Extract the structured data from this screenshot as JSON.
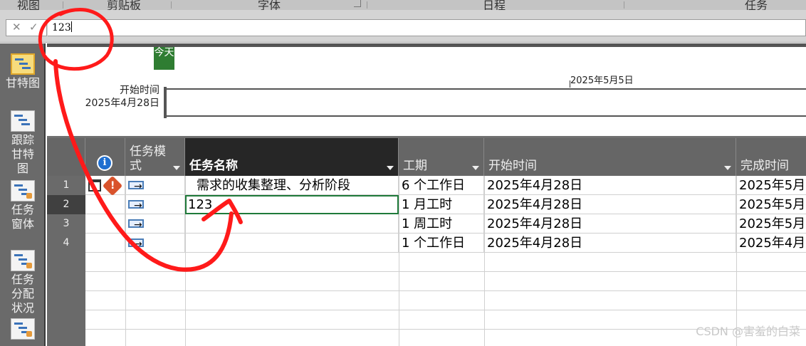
{
  "ribbon": {
    "groups": [
      "视图",
      "剪贴板",
      "字体",
      "日程",
      "任务"
    ]
  },
  "formula_bar": {
    "cancel_icon": "✕",
    "enter_icon": "✓",
    "value": "123"
  },
  "view_bar": {
    "items": [
      {
        "label": "甘特图",
        "icon": "gantt-chart-icon"
      },
      {
        "label": "跟踪甘特图",
        "icon": "tracking-gantt-icon"
      },
      {
        "label": "任务窗体",
        "icon": "task-form-icon"
      },
      {
        "label": "任务分配状况",
        "icon": "task-usage-icon"
      },
      {
        "label": "",
        "icon": "calendar-view-icon"
      }
    ]
  },
  "timeline": {
    "today_label": "今天",
    "start_label": "开始时间",
    "start_date": "2025年4月28日",
    "date_marker": "2025年5月5日"
  },
  "table": {
    "columns": [
      "",
      "任务模式",
      "任务名称",
      "工期",
      "开始时间",
      "完成时间"
    ],
    "rows": [
      {
        "id": "1",
        "name": "需求的收集整理、分析阶段",
        "duration": "6 个工作日",
        "start": "2025年4月28日",
        "finish": "2025年5月",
        "indicators": [
          "calendar-icon",
          "warning-icon"
        ]
      },
      {
        "id": "2",
        "name": "123",
        "duration": "1 月工时",
        "start": "2025年4月28日",
        "finish": "2025年5月",
        "indicators": []
      },
      {
        "id": "3",
        "name": "",
        "duration": "1 周工时",
        "start": "2025年4月28日",
        "finish": "2025年5月",
        "indicators": []
      },
      {
        "id": "4",
        "name": "",
        "duration": "1 个工作日",
        "start": "2025年4月28日",
        "finish": "2025年4月",
        "indicators": []
      }
    ]
  },
  "watermark": "CSDN @害羞的白菜",
  "colors": {
    "today_marker": "#2f7d32",
    "edit_border": "#1f7a3a",
    "annotation": "#ff1a1a"
  }
}
